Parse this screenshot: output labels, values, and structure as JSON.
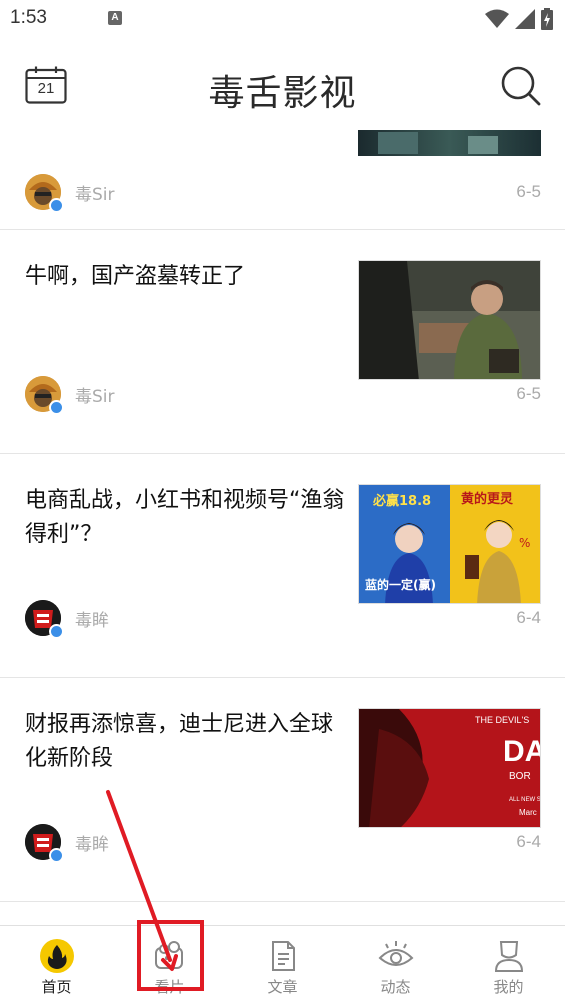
{
  "status_bar": {
    "time": "1:53",
    "notification_icon": "A"
  },
  "header": {
    "calendar_day": "21",
    "app_title": "毒舌影视"
  },
  "articles": [
    {
      "title": "",
      "author": "毒Sir",
      "date": "6-5"
    },
    {
      "title": "牛啊，国产盗墓转正了",
      "author": "毒Sir",
      "date": "6-5"
    },
    {
      "title": "电商乱战，小红书和视频号“渔翁得利”？",
      "author": "毒眸",
      "date": "6-4",
      "thumb_text": {
        "left_top": "必赢18.8",
        "left_bottom": "蓝的一定(赢)",
        "right_top": "黄的更灵",
        "right_symbol": "%"
      }
    },
    {
      "title": "财报再添惊喜，迪士尼进入全球化新阶段",
      "author": "毒眸",
      "date": "6-4",
      "thumb_text": {
        "top": "THE DEVIL'S",
        "big": "DAI",
        "sub": "BOR",
        "small": "ALL NEW S",
        "month": "Marc"
      }
    }
  ],
  "bottom_nav": [
    {
      "label": "首页",
      "icon": "home-flame-icon",
      "active": true
    },
    {
      "label": "看片",
      "icon": "video-camera-icon",
      "active": false
    },
    {
      "label": "文章",
      "icon": "document-icon",
      "active": false
    },
    {
      "label": "动态",
      "icon": "eye-icon",
      "active": false
    },
    {
      "label": "我的",
      "icon": "user-icon",
      "active": false
    }
  ],
  "colors": {
    "accent_yellow": "#f5c800",
    "annotation_red": "#e01b24",
    "verified_blue": "#3b8fe8"
  }
}
